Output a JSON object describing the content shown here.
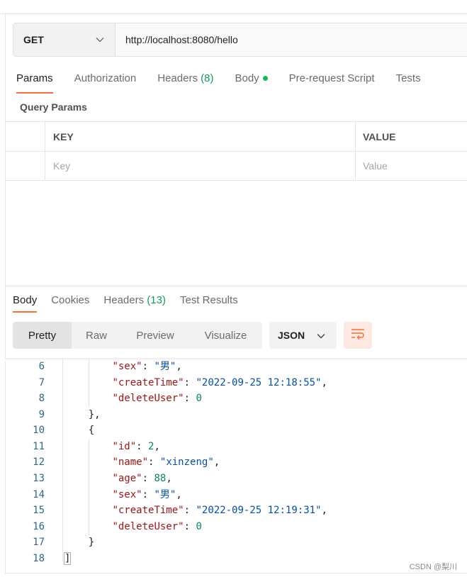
{
  "request": {
    "method": "GET",
    "url": "http://localhost:8080/hello"
  },
  "request_tabs": [
    {
      "label": "Params",
      "active": true
    },
    {
      "label": "Authorization"
    },
    {
      "label": "Headers",
      "count": "(8)"
    },
    {
      "label": "Body",
      "indicator": "green-dot"
    },
    {
      "label": "Pre-request Script"
    },
    {
      "label": "Tests"
    }
  ],
  "query_params": {
    "title": "Query Params",
    "columns": {
      "key": "KEY",
      "value": "VALUE"
    },
    "placeholders": {
      "key": "Key",
      "value": "Value"
    }
  },
  "response_tabs": [
    {
      "label": "Body",
      "active": true
    },
    {
      "label": "Cookies"
    },
    {
      "label": "Headers",
      "count": "(13)"
    },
    {
      "label": "Test Results"
    }
  ],
  "view_modes": [
    "Pretty",
    "Raw",
    "Preview",
    "Visualize"
  ],
  "active_view_mode": "Pretty",
  "format": "JSON",
  "code_lines": [
    {
      "n": "6",
      "key": "sex",
      "str": "男"
    },
    {
      "n": "7",
      "key": "createTime",
      "str": "2022-09-25 12:18:55"
    },
    {
      "n": "8",
      "key": "deleteUser",
      "num": "0",
      "last": true
    },
    {
      "n": "9",
      "punct": "},"
    },
    {
      "n": "10",
      "punct": "{"
    },
    {
      "n": "11",
      "key": "id",
      "num": "2"
    },
    {
      "n": "12",
      "key": "name",
      "str": "xinzeng"
    },
    {
      "n": "13",
      "key": "age",
      "num": "88"
    },
    {
      "n": "14",
      "key": "sex",
      "str": "男"
    },
    {
      "n": "15",
      "key": "createTime",
      "str": "2022-09-25 12:19:31"
    },
    {
      "n": "16",
      "key": "deleteUser",
      "num": "0",
      "last": true
    },
    {
      "n": "17",
      "punct": "}"
    },
    {
      "n": "18",
      "punct": "]"
    }
  ],
  "watermark": "CSDN @梨川",
  "colors": {
    "accent": "#ff6c37",
    "count": "#0f9e5c",
    "json_key": "#a31515",
    "json_string": "#0451a5",
    "json_number": "#098658"
  }
}
